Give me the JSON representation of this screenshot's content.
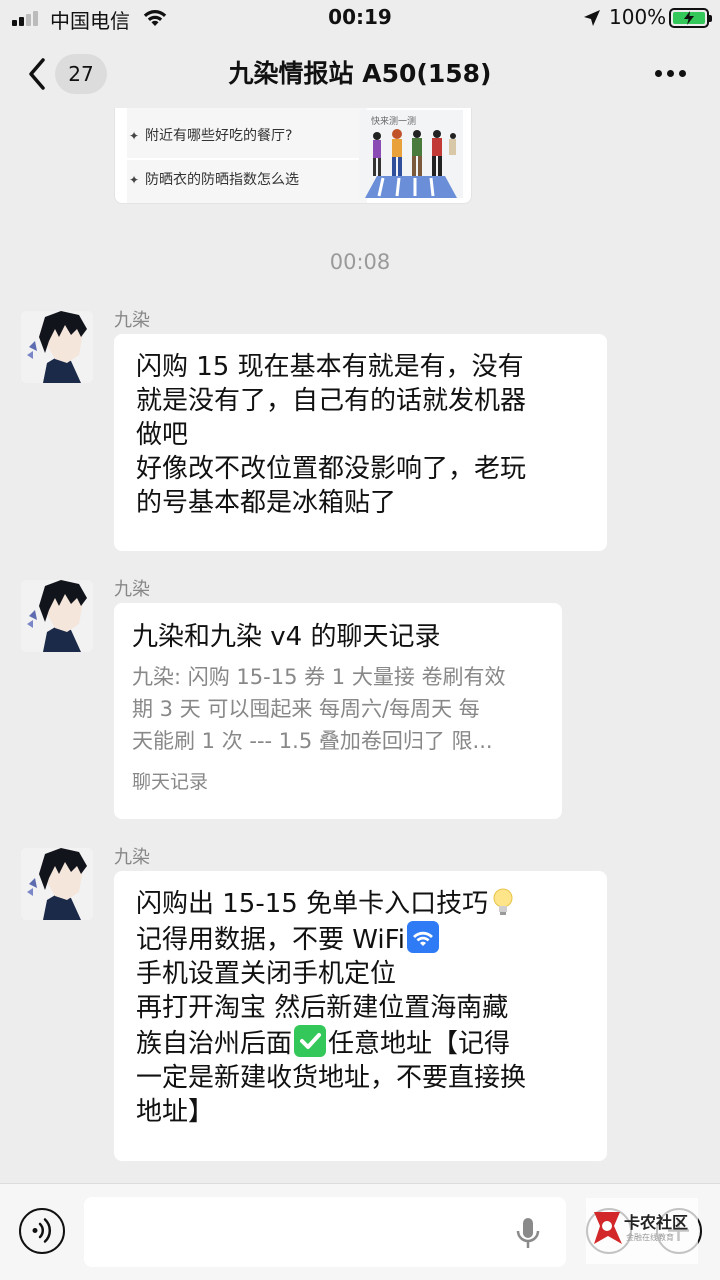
{
  "status_bar": {
    "carrier": "中国电信",
    "time": "00:19",
    "battery": "100%"
  },
  "nav": {
    "back_count": "27",
    "title": "九染情报站 A50(158)"
  },
  "top_card": {
    "suggestion_1": "附近有哪些好吃的餐厅?",
    "suggestion_2": "防晒衣的防晒指数怎么选",
    "illustration_caption": "快来测一测",
    "sparkle": "✦"
  },
  "time_separator": "00:08",
  "messages": [
    {
      "sender": "九染",
      "lines": [
        "闪购 15 现在基本有就是有，没有",
        "就是没有了，自己有的话就发机器",
        "做吧",
        "好像改不改位置都没影响了，老玩",
        "的号基本都是冰箱贴了"
      ]
    },
    {
      "sender": "九染",
      "record_title": "九染和九染 v4 的聊天记录",
      "record_preview": [
        "九染: 闪购 15-15 券 1 大量接 卷刷有效",
        "期 3 天 可以囤起来 每周六/每周天 每",
        "天能刷 1 次 --- 1.5 叠加卷回归了 限..."
      ],
      "record_footer": "聊天记录"
    },
    {
      "sender": "九染",
      "lines": [
        "闪购出 15-15 免单卡入口技巧",
        "记得用数据，不要 WiFi",
        "手机设置关闭手机定位",
        "再打开淘宝 然后新建位置海南藏",
        "族自治州后面",
        "任意地址【记得",
        "一定是新建收货地址，不要直接换",
        "地址】"
      ]
    }
  ],
  "input_bar": {
    "placeholder": "",
    "watermark": "卡农社区",
    "watermark_sub": "金融在线教育"
  }
}
